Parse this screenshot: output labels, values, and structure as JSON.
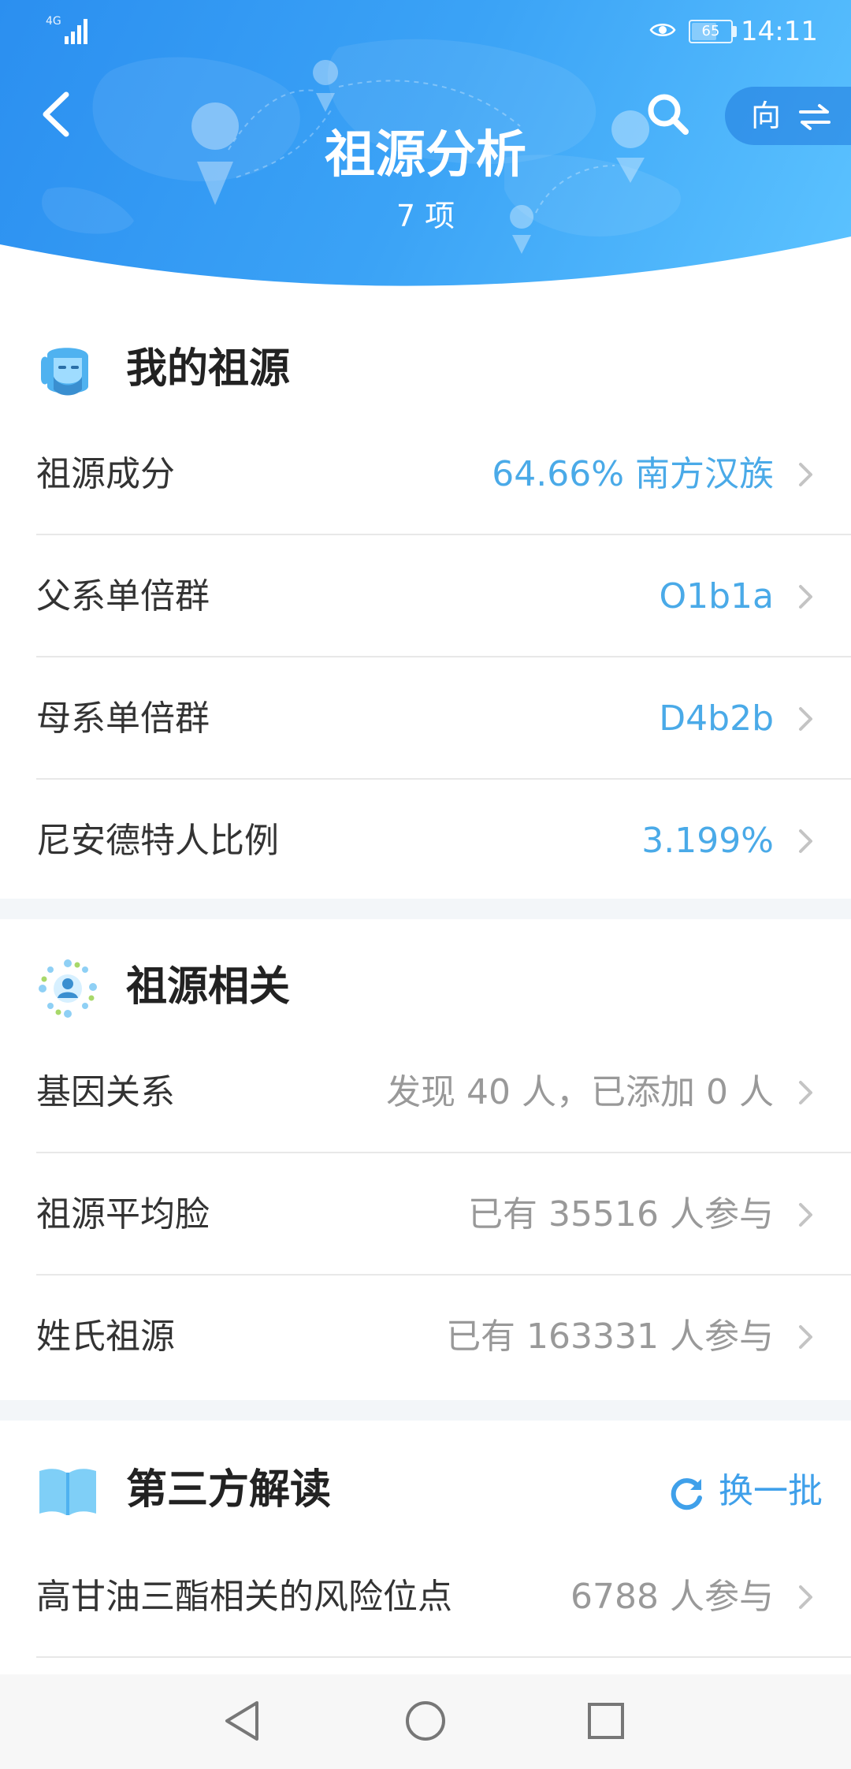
{
  "status": {
    "network": "4G",
    "battery": "65",
    "battery_level": 0.65,
    "time": "14:11"
  },
  "header": {
    "title": "祖源分析",
    "subtitle": "7 项",
    "switch_label": "向",
    "icons": {
      "back": "chevron-left-icon",
      "search": "search-icon",
      "switch": "swap-arrows-icon"
    }
  },
  "sections": {
    "my_ancestry": {
      "title": "我的祖源",
      "icon": "avatar-face-icon",
      "rows": [
        {
          "label": "祖源成分",
          "value": "64.66% 南方汉族"
        },
        {
          "label": "父系单倍群",
          "value": "O1b1a"
        },
        {
          "label": "母系单倍群",
          "value": "D4b2b"
        },
        {
          "label": "尼安德特人比例",
          "value": "3.199%"
        }
      ]
    },
    "related": {
      "title": "祖源相关",
      "icon": "people-network-icon",
      "rows": [
        {
          "label": "基因关系",
          "value": "发现 40 人，已添加 0 人"
        },
        {
          "label": "祖源平均脸",
          "value": "已有 35516 人参与"
        },
        {
          "label": "姓氏祖源",
          "value": "已有 163331 人参与"
        }
      ]
    },
    "third_party": {
      "title": "第三方解读",
      "icon": "open-book-icon",
      "refresh_label": "换一批",
      "rows": [
        {
          "label": "高甘油三酯相关的风险位点",
          "value": "6788 人参与"
        }
      ]
    }
  },
  "colors": {
    "header_gradient_start": "#2b8ff0",
    "header_gradient_end": "#5cc3ff",
    "accent_value": "#4aaae8",
    "gray_value": "#999999",
    "section_gap": "#f3f6f9"
  },
  "nav": {
    "back": "triangle-back-icon",
    "home": "circle-home-icon",
    "recents": "square-recents-icon"
  }
}
